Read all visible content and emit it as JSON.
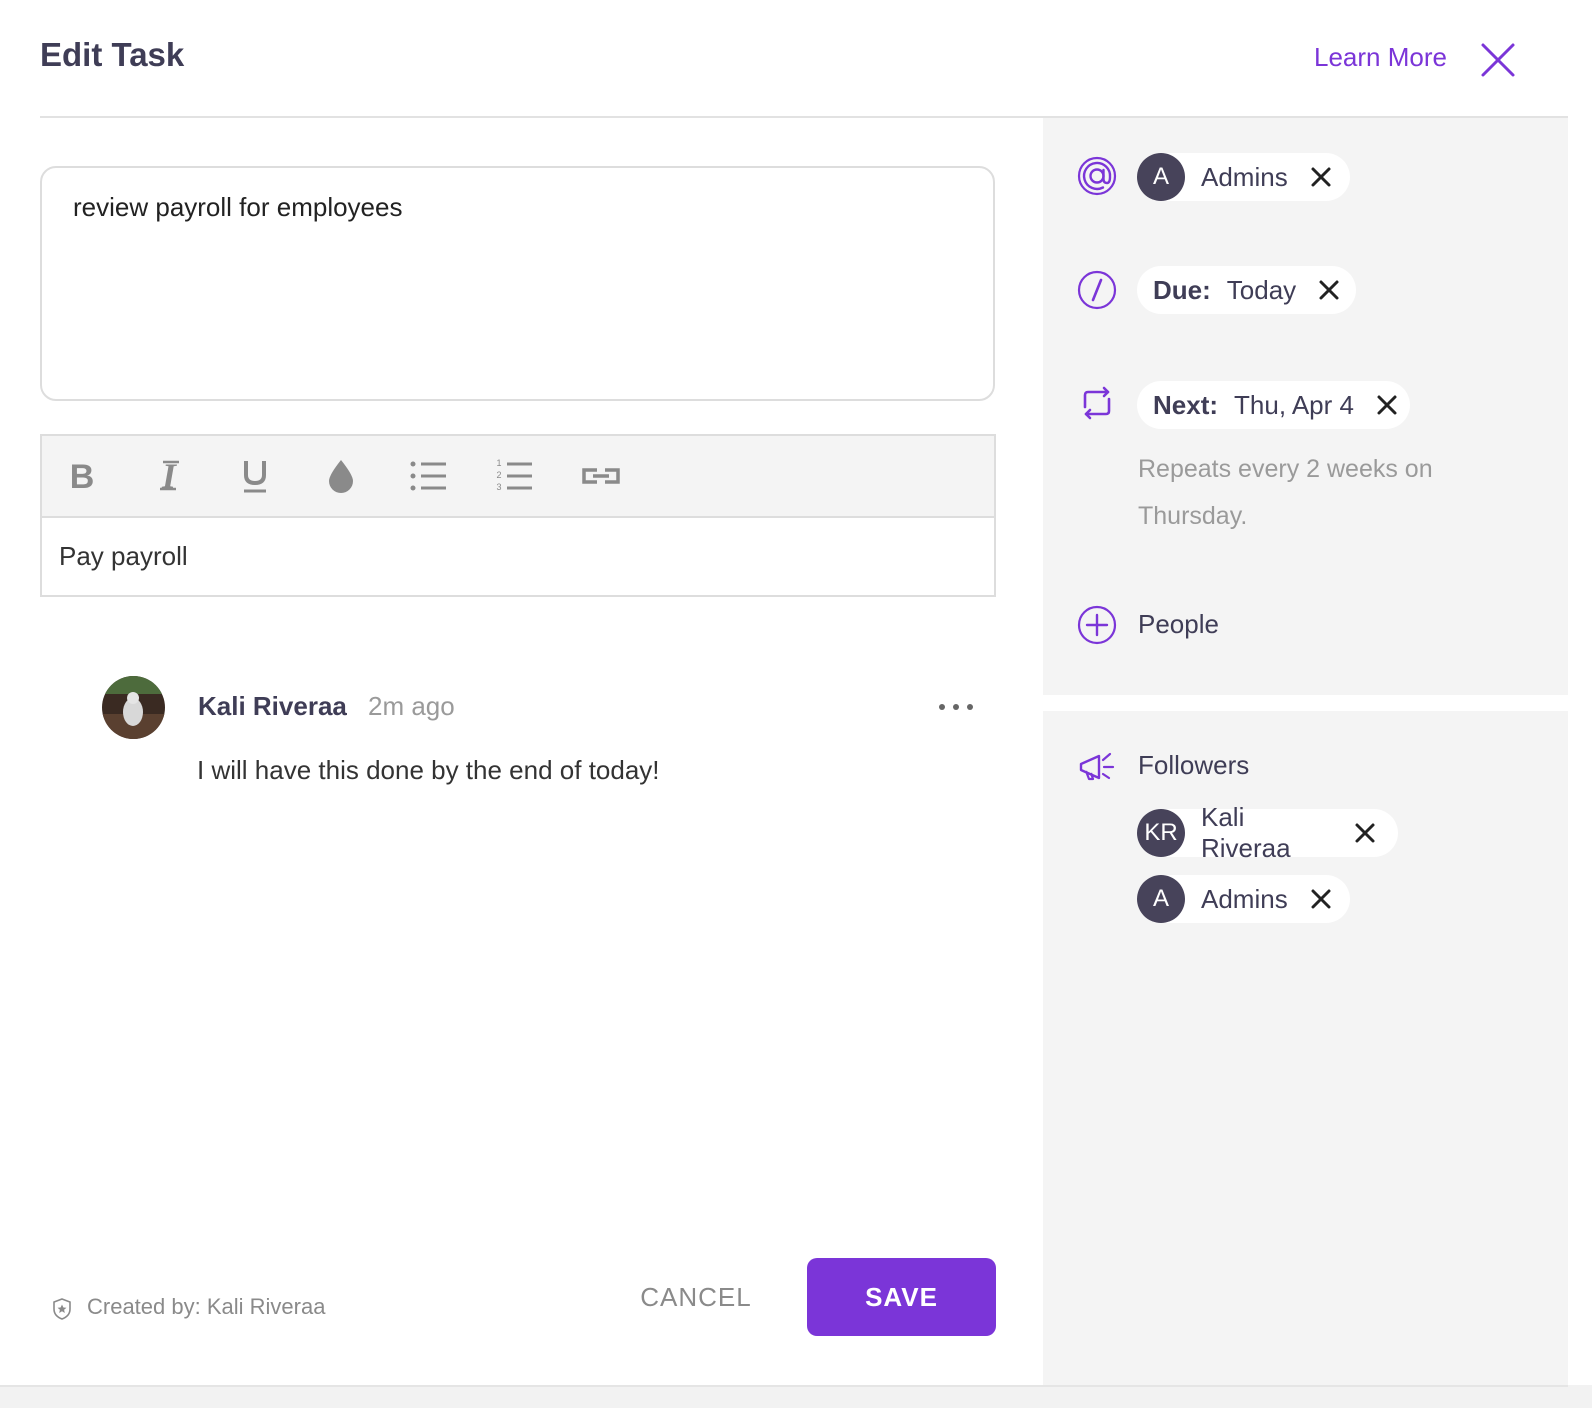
{
  "header": {
    "title": "Edit Task",
    "learn_more": "Learn More"
  },
  "task": {
    "description": "review payroll for employees",
    "editor_text": "Pay payroll"
  },
  "toolbar": {
    "tools": [
      "bold-icon",
      "italic-icon",
      "underline-icon",
      "color-drop-icon",
      "bullet-list-icon",
      "numbered-list-icon",
      "link-icon"
    ]
  },
  "comment": {
    "author": "Kali Riveraa",
    "time": "2m ago",
    "body": "I will have this done by the end of today!"
  },
  "footer": {
    "created_by": "Created by: Kali Riveraa",
    "cancel": "CANCEL",
    "save": "SAVE"
  },
  "side": {
    "assignee": {
      "initial": "A",
      "name": "Admins"
    },
    "due": {
      "label": "Due:",
      "value": "Today"
    },
    "next": {
      "label": "Next:",
      "value": "Thu, Apr 4"
    },
    "repeat_text": "Repeats  every 2 weeks on Thursday.",
    "people_label": "People",
    "followers_label": "Followers",
    "followers": [
      {
        "initial": "KR",
        "name": "Kali Riveraa"
      },
      {
        "initial": "A",
        "name": "Admins"
      }
    ]
  },
  "colors": {
    "accent": "#7b35d8",
    "title": "#3f3d56",
    "panel_bg": "#f4f4f4",
    "avatar_bg": "#47435a"
  }
}
